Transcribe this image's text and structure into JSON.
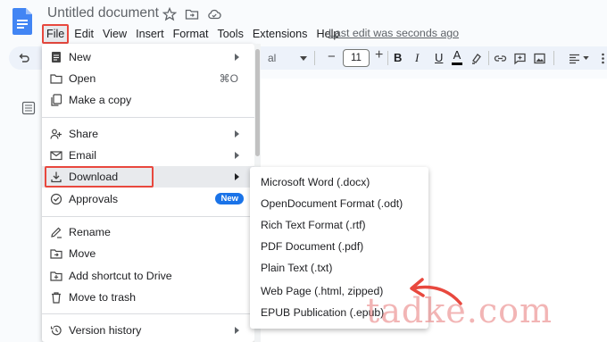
{
  "document": {
    "title": "Untitled document",
    "last_edit": "Last edit was seconds ago"
  },
  "menubar": [
    "File",
    "Edit",
    "View",
    "Insert",
    "Format",
    "Tools",
    "Extensions",
    "Help"
  ],
  "toolbar": {
    "font_partial": "al",
    "font_size": "11",
    "minus": "−",
    "plus": "+",
    "bold": "B",
    "italic": "I",
    "underline": "U",
    "text_color": "A"
  },
  "file_menu": {
    "items": [
      {
        "label": "New",
        "icon": "document-icon",
        "submenu": true
      },
      {
        "label": "Open",
        "icon": "folder-icon",
        "shortcut": "⌘O"
      },
      {
        "label": "Make a copy",
        "icon": "copy-icon"
      },
      {
        "label": "Share",
        "icon": "share-icon",
        "submenu": true
      },
      {
        "label": "Email",
        "icon": "email-icon",
        "submenu": true
      },
      {
        "label": "Download",
        "icon": "download-icon",
        "submenu": true,
        "highlighted": true
      },
      {
        "label": "Approvals",
        "icon": "approvals-icon",
        "badge": "New"
      },
      {
        "label": "Rename",
        "icon": "rename-icon"
      },
      {
        "label": "Move",
        "icon": "move-icon"
      },
      {
        "label": "Add shortcut to Drive",
        "icon": "add-shortcut-icon"
      },
      {
        "label": "Move to trash",
        "icon": "trash-icon"
      },
      {
        "label": "Version history",
        "icon": "history-icon",
        "submenu": true
      }
    ]
  },
  "download_menu": {
    "items": [
      "Microsoft Word (.docx)",
      "OpenDocument Format (.odt)",
      "Rich Text Format (.rtf)",
      "PDF Document (.pdf)",
      "Plain Text (.txt)",
      "Web Page (.html, zipped)",
      "EPUB Publication (.epub)"
    ]
  },
  "watermark": "tadke.com",
  "colors": {
    "accent_red": "#e8483e",
    "badge_blue": "#1a73e8",
    "docs_blue": "#4285f4",
    "toolbar_bg": "#edf2fa"
  }
}
